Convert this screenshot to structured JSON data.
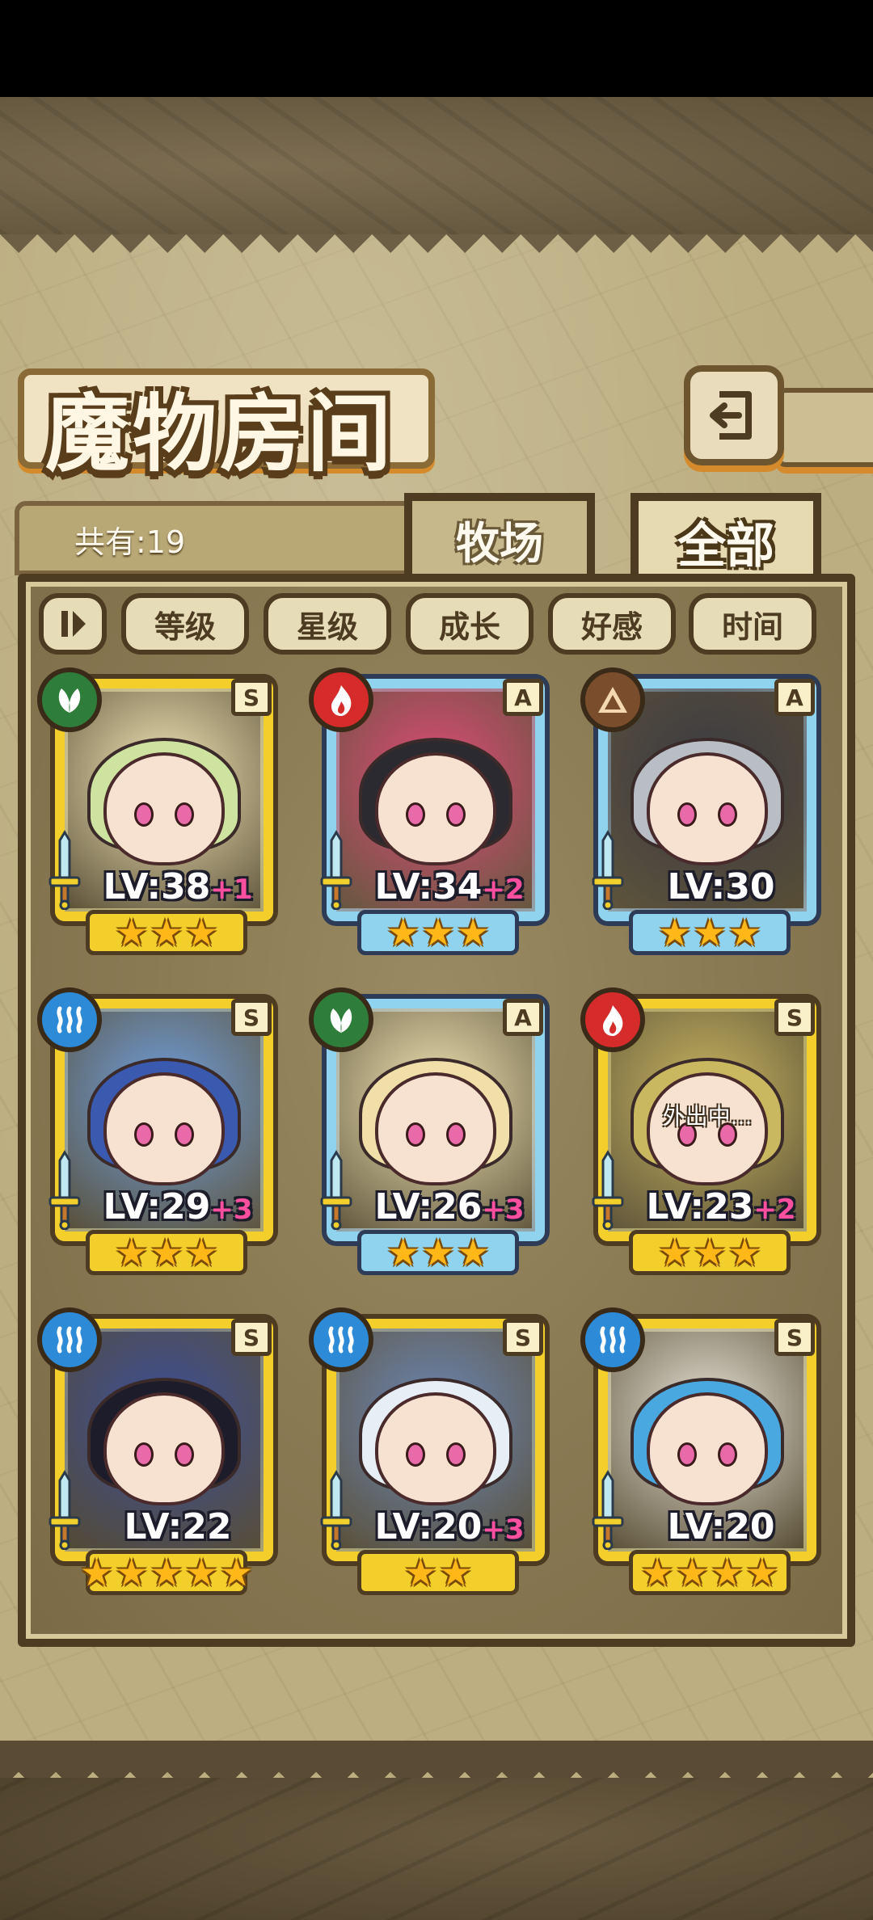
{
  "header": {
    "title": "魔物房间",
    "total_count": "共有:19"
  },
  "tabs": [
    {
      "label": "牧场",
      "selected": false
    },
    {
      "label": "全部",
      "selected": true
    }
  ],
  "sort_buttons": [
    "等级",
    "星级",
    "成长",
    "好感",
    "时间"
  ],
  "colors": {
    "gold_frame": "#f2cf2a",
    "blue_frame": "#8fd3ee",
    "bonus_text": "#ff4fa0",
    "grass": "#2f7d3a",
    "fire": "#d52b2b",
    "earth": "#7a4e2c",
    "water": "#2d8ad6"
  },
  "monsters": [
    {
      "element": "grass",
      "grade": "S",
      "frame": "gold",
      "level": "LV:38",
      "bonus": "+1",
      "stars": 3,
      "status": "",
      "hair": "#cfe3a0",
      "bg": "#f3e6b8"
    },
    {
      "element": "fire",
      "grade": "A",
      "frame": "blue",
      "level": "LV:34",
      "bonus": "+2",
      "stars": 3,
      "status": "",
      "hair": "#2a2a30",
      "bg": "#e04a78"
    },
    {
      "element": "earth",
      "grade": "A",
      "frame": "blue",
      "level": "LV:30",
      "bonus": "",
      "stars": 3,
      "status": "",
      "hair": "#b9bec4",
      "bg": "#3a3a44"
    },
    {
      "element": "water",
      "grade": "S",
      "frame": "gold",
      "level": "LV:29",
      "bonus": "+3",
      "stars": 3,
      "status": "",
      "hair": "#3a5ab0",
      "bg": "#6fa0e0"
    },
    {
      "element": "grass",
      "grade": "A",
      "frame": "blue",
      "level": "LV:26",
      "bonus": "+3",
      "stars": 3,
      "status": "",
      "hair": "#f0dfa8",
      "bg": "#efe3b4"
    },
    {
      "element": "fire",
      "grade": "S",
      "frame": "gold",
      "level": "LV:23",
      "bonus": "+2",
      "stars": 3,
      "status": "外出中...",
      "hair": "#c9b860",
      "bg": "#c8b660"
    },
    {
      "element": "water",
      "grade": "S",
      "frame": "gold",
      "level": "LV:22",
      "bonus": "",
      "stars": 5,
      "status": "",
      "hair": "#1c1c2a",
      "bg": "#3a4e9a"
    },
    {
      "element": "water",
      "grade": "S",
      "frame": "gold",
      "level": "LV:20",
      "bonus": "+3",
      "stars": 2,
      "status": "",
      "hair": "#e8eef6",
      "bg": "#6b87b8"
    },
    {
      "element": "water",
      "grade": "S",
      "frame": "gold",
      "level": "LV:20",
      "bonus": "",
      "stars": 4,
      "status": "",
      "hair": "#4aa8e0",
      "bg": "#e8e4d8"
    }
  ]
}
